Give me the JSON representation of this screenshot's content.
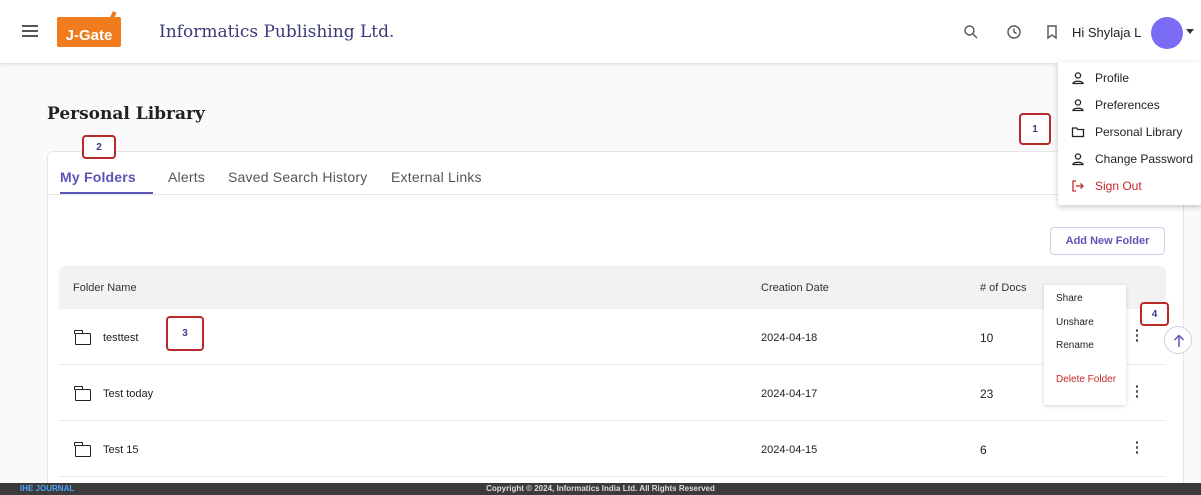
{
  "header": {
    "logo_text": "J-Gate",
    "org_name": "Informatics Publishing Ltd.",
    "greeting": "Hi Shylaja L",
    "icons": [
      "menu-icon",
      "search-icon",
      "history-icon",
      "bookmark-icon",
      "chevron-down-icon"
    ],
    "avatar_color": "#7b6cf6"
  },
  "user_menu": {
    "items": [
      {
        "label": "Profile",
        "icon": "person-icon"
      },
      {
        "label": "Preferences",
        "icon": "person-icon"
      },
      {
        "label": "Personal Library",
        "icon": "folder-icon"
      },
      {
        "label": "Change Password",
        "icon": "person-icon"
      },
      {
        "label": "Sign Out",
        "icon": "sign-out-icon"
      }
    ]
  },
  "page": {
    "title": "Personal Library"
  },
  "tabs": [
    {
      "label": "My Folders",
      "active": true
    },
    {
      "label": "Alerts",
      "active": false
    },
    {
      "label": "Saved Search History",
      "active": false
    },
    {
      "label": "External Links",
      "active": false
    }
  ],
  "toolbar": {
    "add_folder_label": "Add New Folder"
  },
  "table": {
    "columns": [
      "Folder Name",
      "Creation Date",
      "# of Docs"
    ],
    "rows": [
      {
        "name": "testtest",
        "date": "2024-04-18",
        "docs": "10"
      },
      {
        "name": "Test today",
        "date": "2024-04-17",
        "docs": "23"
      },
      {
        "name": "Test 15",
        "date": "2024-04-15",
        "docs": "6"
      }
    ]
  },
  "row_menu": {
    "items": [
      {
        "label": "Share"
      },
      {
        "label": "Unshare"
      },
      {
        "label": "Rename"
      },
      {
        "label": "Delete Folder"
      }
    ]
  },
  "callouts": [
    "1",
    "2",
    "3",
    "4"
  ],
  "footer": {
    "left_text": "IHE JOURNAL",
    "copyright": "Copyright © 2024, Informatics India Ltd. All Rights Reserved"
  },
  "colors": {
    "accent": "#5b55b8",
    "brand_orange": "#f07c1e",
    "danger": "#c62828",
    "callout_border": "#b72a2a"
  }
}
